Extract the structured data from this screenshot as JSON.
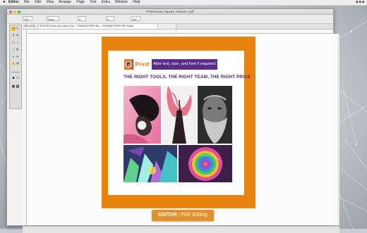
{
  "menubar": {
    "menus": [
      "Editor",
      "File",
      "Edit",
      "View",
      "Arrange",
      "Page",
      "Text",
      "Extra",
      "Window",
      "Help"
    ]
  },
  "window": {
    "title": "PrintFactory Square A5x5x5-1.pdf"
  },
  "controlbar": {
    "fields": [
      "100",
      "None",
      "0",
      "0",
      "100"
    ]
  },
  "tabs": [
    "100 x 100",
    "EDITOR Cover A4 (Letter) 10x... / PrintFACTORY Ed... / PrintFACTORY PDF Editor",
    ""
  ],
  "document": {
    "banner_logo": "Print!",
    "banner_text": "Alter text, size, and font if required",
    "headline": "THE RIGHT TOOLS, THE RIGHT TEAM, THE RIGHT PRICE"
  },
  "caption": {
    "bold": "EDITOR",
    "separator": "|",
    "rest": "PDF Editing"
  },
  "colors": {
    "border_orange": "#e8830f",
    "banner_purple": "#5a2d8a",
    "headline_purple": "#4a2375",
    "caption_orange": "#e2902c"
  },
  "icons": [
    "apple-icon",
    "selection-tool-icon",
    "text-tool-icon",
    "zoom-tool-icon",
    "hand-tool-icon"
  ]
}
